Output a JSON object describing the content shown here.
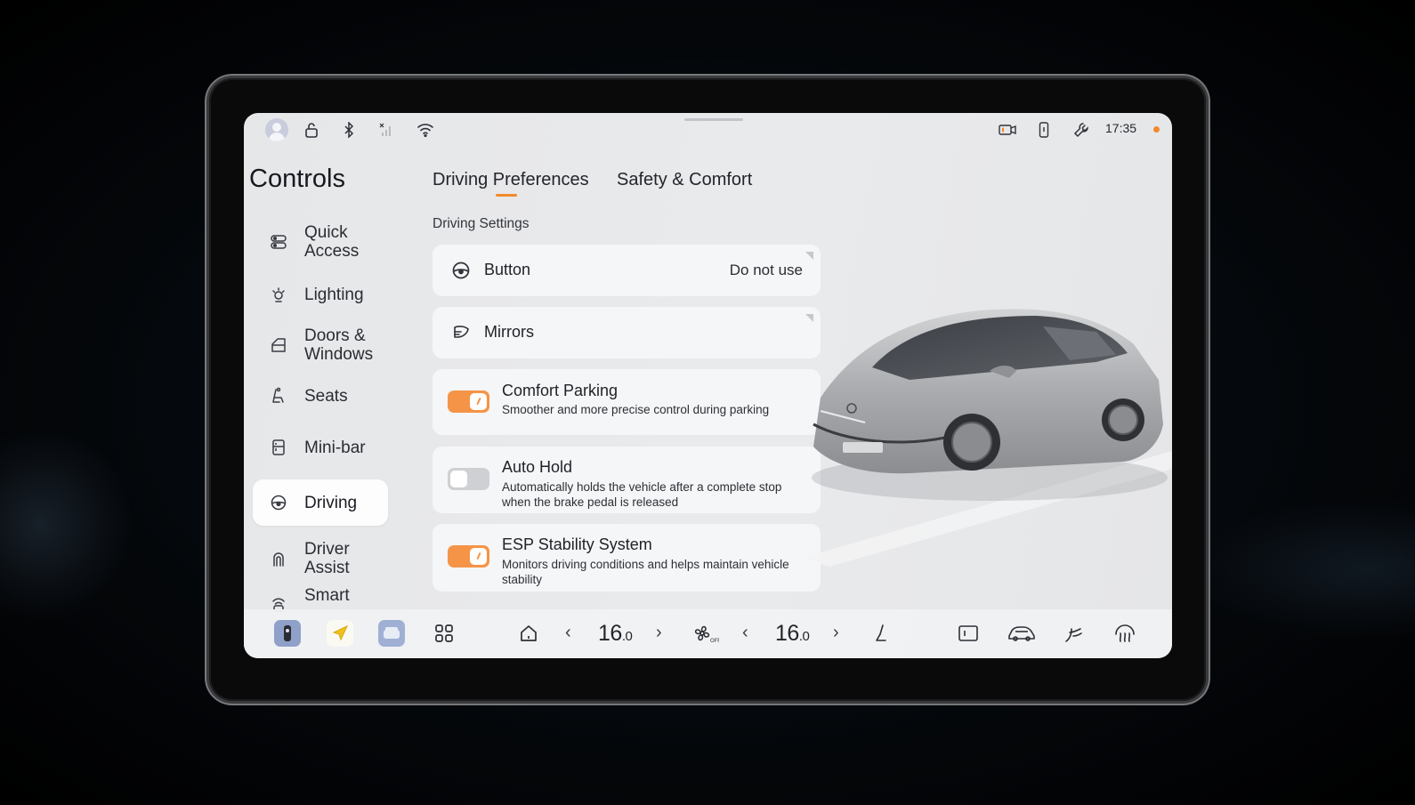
{
  "status_bar": {
    "time": "17:35",
    "icons": [
      "avatar-icon",
      "unlock-icon",
      "bluetooth-icon",
      "cellular-off-icon",
      "wifi-icon",
      "dashcam-icon",
      "phone-key-icon",
      "wrench-icon"
    ],
    "notification_color": "#f28a2c"
  },
  "sidebar": {
    "title": "Controls",
    "items": [
      {
        "id": "quick-access",
        "label": "Quick Access",
        "icon": "toggles-icon"
      },
      {
        "id": "lighting",
        "label": "Lighting",
        "icon": "light-icon"
      },
      {
        "id": "doors-windows",
        "label": "Doors & Windows",
        "icon": "door-icon"
      },
      {
        "id": "seats",
        "label": "Seats",
        "icon": "seat-icon"
      },
      {
        "id": "mini-bar",
        "label": "Mini-bar",
        "icon": "fridge-icon"
      },
      {
        "id": "driving",
        "label": "Driving",
        "icon": "steering-wheel-icon",
        "active": true
      },
      {
        "id": "driver-assist",
        "label": "Driver Assist",
        "icon": "assist-icon"
      },
      {
        "id": "smart",
        "label": "Smart",
        "icon": "smart-icon"
      }
    ]
  },
  "tabs": [
    {
      "label": "Driving Preferences",
      "active": true
    },
    {
      "label": "Safety & Comfort",
      "active": false
    }
  ],
  "section_title": "Driving Settings",
  "settings": {
    "button": {
      "title": "Button",
      "value": "Do not use",
      "icon": "steering-wheel-icon"
    },
    "mirrors": {
      "title": "Mirrors",
      "icon": "mirror-icon"
    },
    "comfort_parking": {
      "title": "Comfort Parking",
      "description": "Smoother and more precise control during parking",
      "enabled": true
    },
    "auto_hold": {
      "title": "Auto Hold",
      "description": "Automatically holds the vehicle after a complete stop when the brake pedal is released",
      "enabled": false
    },
    "esp": {
      "title": "ESP Stability System",
      "description": "Monitors driving conditions and helps maintain vehicle stability",
      "enabled": true
    }
  },
  "dock": {
    "apps": [
      "dashcam-app",
      "navigation-app",
      "car-app"
    ],
    "left_temp": {
      "whole": "16",
      "decimal": "0"
    },
    "right_temp": {
      "whole": "16",
      "decimal": "0"
    },
    "icons": [
      "apps-grid-icon",
      "home-icon",
      "fan-off-icon",
      "seat-heat-icon",
      "screen-icon",
      "car-climate-icon",
      "airflow-icon",
      "defrost-icon"
    ]
  },
  "colors": {
    "accent": "#f59447",
    "screen_bg": "#e7e8ea",
    "active_item_bg": "#fdfdfe"
  }
}
